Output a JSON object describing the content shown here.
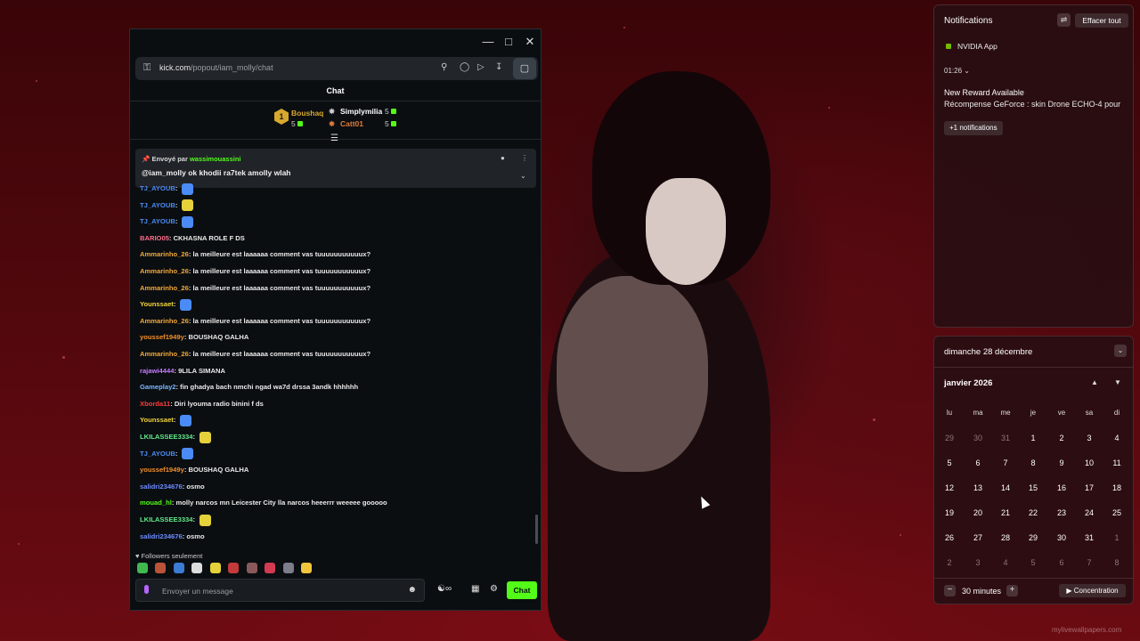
{
  "chat": {
    "url_host": "kick.com",
    "url_path": "/popout/iam_molly/chat",
    "title": "Chat",
    "leaderboard": [
      {
        "rank": "1",
        "name": "Boushaq",
        "count": "5",
        "color": "#d7a82d"
      },
      {
        "name": "Simplymilia",
        "count": "5",
        "color": "#ffffff"
      },
      {
        "name": "Catt01",
        "count": "5",
        "color": "#e07a3a"
      }
    ],
    "pinned": {
      "sent_by": "Envoyé par",
      "user": "wassimouassini",
      "message": "@iam_molly ok khodii ra7tek amolly wlah"
    },
    "messages": [
      {
        "user": "TJ_AYOUB",
        "text": "",
        "color": "#4b8bf5"
      },
      {
        "user": "TJ_AYOUB",
        "text": "",
        "color": "#4b8bf5"
      },
      {
        "user": "TJ_AYOUB",
        "text": "",
        "color": "#4b8bf5"
      },
      {
        "user": "BARIO05",
        "text": "CKHASNA ROLE F DS",
        "color": "#ff6b8a"
      },
      {
        "user": "Ammarinho_26",
        "text": "la meilleure est laaaaaa comment vas tuuuuuuuuuuux?",
        "color": "#f2a93b"
      },
      {
        "user": "Ammarinho_26",
        "text": "la meilleure est laaaaaa comment vas tuuuuuuuuuuux?",
        "color": "#f2a93b"
      },
      {
        "user": "Ammarinho_26",
        "text": "la meilleure est laaaaaa comment vas tuuuuuuuuuuux?",
        "color": "#f2a93b"
      },
      {
        "user": "Younssaet",
        "text": "",
        "color": "#f2d33b"
      },
      {
        "user": "Ammarinho_26",
        "text": "la meilleure est laaaaaa comment vas tuuuuuuuuuuux?",
        "color": "#f2a93b"
      },
      {
        "user": "youssef1949y",
        "text": "BOUSHAQ GALHA",
        "color": "#f28f2b"
      },
      {
        "user": "Ammarinho_26",
        "text": "la meilleure est laaaaaa comment vas tuuuuuuuuuuux?",
        "color": "#f2a93b"
      },
      {
        "user": "rajawi4444",
        "text": "9LILA SIMANA",
        "color": "#c67cff"
      },
      {
        "user": "Gameplay2",
        "text": "fin ghadya bach nmchi ngad wa7d drssa 3andk hhhhhh",
        "color": "#7ab8ff"
      },
      {
        "user": "Xborda11",
        "text": "Diri lyouma radio binini f ds",
        "color": "#ff3b3b"
      },
      {
        "user": "Younssaet",
        "text": "",
        "color": "#f2d33b"
      },
      {
        "user": "LKILASSEE3334",
        "text": "",
        "color": "#62e88a"
      },
      {
        "user": "TJ_AYOUB",
        "text": "",
        "color": "#4b8bf5"
      },
      {
        "user": "youssef1949y",
        "text": "BOUSHAQ GALHA",
        "color": "#f28f2b"
      },
      {
        "user": "salidri234676",
        "text": "osmo",
        "color": "#6b8cff"
      },
      {
        "user": "mouad_hl",
        "text": "molly narcos mn Leicester City lla narcos heeerrr weeeee gooooo",
        "color": "#53fc18"
      },
      {
        "user": "LKILASSEE3334",
        "text": "",
        "color": "#62e88a"
      },
      {
        "user": "salidri234676",
        "text": "osmo",
        "color": "#6b8cff"
      }
    ],
    "followers_only": "Followers seulement",
    "input_placeholder": "Envoyer un message",
    "send_label": "Chat",
    "accent": "#53fc18"
  },
  "notifications": {
    "title": "Notifications",
    "clear_all": "Effacer tout",
    "app": "NVIDIA App",
    "time": "01:26",
    "reward_title": "New Reward Available",
    "reward_body": "Récompense GeForce : skin Drone ECHO-4 pour",
    "more": "+1 notifications"
  },
  "calendar": {
    "full_date": "dimanche 28 décembre",
    "month": "janvier 2026",
    "weekdays": [
      "lu",
      "ma",
      "me",
      "je",
      "ve",
      "sa",
      "di"
    ],
    "weeks": [
      [
        {
          "d": "29",
          "o": true
        },
        {
          "d": "30",
          "o": true
        },
        {
          "d": "31",
          "o": true
        },
        {
          "d": "1"
        },
        {
          "d": "2"
        },
        {
          "d": "3"
        },
        {
          "d": "4"
        }
      ],
      [
        {
          "d": "5"
        },
        {
          "d": "6"
        },
        {
          "d": "7"
        },
        {
          "d": "8"
        },
        {
          "d": "9"
        },
        {
          "d": "10"
        },
        {
          "d": "11"
        }
      ],
      [
        {
          "d": "12"
        },
        {
          "d": "13"
        },
        {
          "d": "14"
        },
        {
          "d": "15"
        },
        {
          "d": "16"
        },
        {
          "d": "17"
        },
        {
          "d": "18"
        }
      ],
      [
        {
          "d": "19"
        },
        {
          "d": "20"
        },
        {
          "d": "21"
        },
        {
          "d": "22"
        },
        {
          "d": "23"
        },
        {
          "d": "24"
        },
        {
          "d": "25"
        }
      ],
      [
        {
          "d": "26"
        },
        {
          "d": "27"
        },
        {
          "d": "28"
        },
        {
          "d": "29"
        },
        {
          "d": "30"
        },
        {
          "d": "31"
        },
        {
          "d": "1",
          "o": true
        }
      ],
      [
        {
          "d": "2",
          "o": true
        },
        {
          "d": "3",
          "o": true
        },
        {
          "d": "4",
          "o": true
        },
        {
          "d": "5",
          "o": true
        },
        {
          "d": "6",
          "o": true
        },
        {
          "d": "7",
          "o": true
        },
        {
          "d": "8",
          "o": true
        }
      ]
    ],
    "focus_minutes": "30 minutes",
    "focus_label": "Concentration"
  },
  "watermark": "mylivewallpapers.com"
}
